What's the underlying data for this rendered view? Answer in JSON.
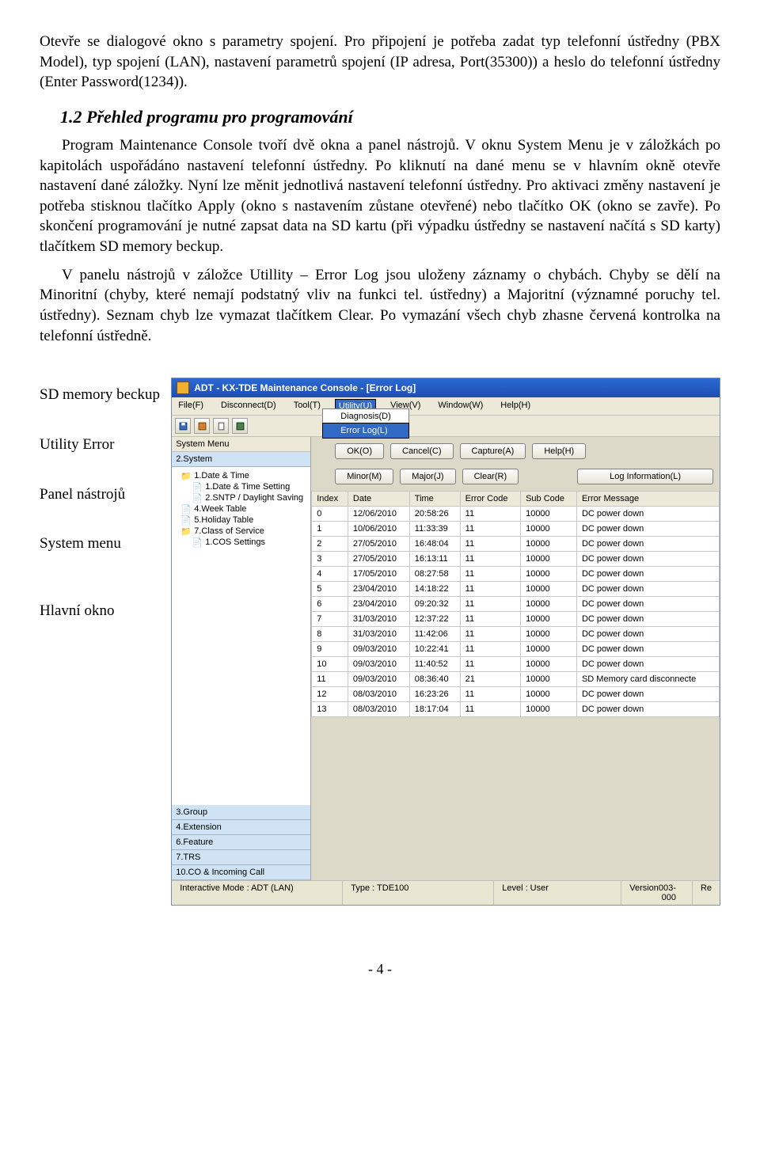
{
  "doc": {
    "para1": "Otevře se dialogové okno s parametry spojení. Pro připojení je potřeba zadat typ telefonní ústředny (PBX Model), typ spojení (LAN), nastavení parametrů spojení (IP adresa, Port(35300)) a heslo do telefonní ústředny (Enter Password(1234)).",
    "section_title": "1.2   Přehled programu pro programování",
    "para2": "Program Maintenance Console tvoří dvě okna a panel nástrojů. V oknu System Menu je v záložkách po kapitolách uspořádáno nastavení telefonní ústředny. Po kliknutí na dané menu se v hlavním okně otevře nastavení dané záložky. Nyní lze měnit jednotlivá nastavení telefonní ústředny. Pro aktivaci změny nastavení je potřeba stisknou tlačítko Apply (okno s nastavením zůstane otevřené) nebo tlačítko OK (okno se zavře). Po skončení programování je nutné zapsat data na SD kartu (při výpadku ústředny se nastavení načítá s SD karty) tlačítkem SD memory beckup.",
    "para3": "V panelu nástrojů v záložce Utillity – Error Log jsou uloženy záznamy o chybách. Chyby se dělí na Minoritní (chyby, které nemají podstatný vliv na funkci tel. ústředny) a Majoritní (významné poruchy tel. ústředny). Seznam chyb lze vymazat tlačítkem Clear. Po vymazání všech chyb zhasne červená kontrolka na telefonní ústředně.",
    "footer": "- 4 -"
  },
  "labels": {
    "l1": "SD memory beckup",
    "l2": "Utility Error",
    "l3": "Panel nástrojů",
    "l4": "System menu",
    "l5": "Hlavní okno"
  },
  "app": {
    "title": "ADT - KX-TDE Maintenance Console - [Error Log]",
    "menu": [
      "File(F)",
      "Disconnect(D)",
      "Tool(T)",
      "Utility(U)",
      "View(V)",
      "Window(W)",
      "Help(H)"
    ],
    "dropdown": {
      "item1": "Diagnosis(D)",
      "item2": "Error Log(L)"
    },
    "sidebar_head": "System Menu",
    "acc_top": "2.System",
    "tree": [
      "1.Date & Time",
      "1.Date & Time Setting",
      "2.SNTP / Daylight Saving",
      "4.Week Table",
      "5.Holiday Table",
      "7.Class of Service",
      "1.COS Settings"
    ],
    "acc_bottom": [
      "3.Group",
      "4.Extension",
      "6.Feature",
      "7.TRS",
      "10.CO & Incoming Call"
    ],
    "buttons1": [
      "OK(O)",
      "Cancel(C)",
      "Capture(A)",
      "Help(H)"
    ],
    "buttons2": [
      "Minor(M)",
      "Major(J)",
      "Clear(R)",
      "Log Information(L)"
    ],
    "grid": {
      "headers": [
        "Index",
        "Date",
        "Time",
        "Error Code",
        "Sub Code",
        "Error Message"
      ],
      "rows": [
        [
          "0",
          "12/06/2010",
          "20:58:26",
          "11",
          "10000",
          "DC power down"
        ],
        [
          "1",
          "10/06/2010",
          "11:33:39",
          "11",
          "10000",
          "DC power down"
        ],
        [
          "2",
          "27/05/2010",
          "16:48:04",
          "11",
          "10000",
          "DC power down"
        ],
        [
          "3",
          "27/05/2010",
          "16:13:11",
          "11",
          "10000",
          "DC power down"
        ],
        [
          "4",
          "17/05/2010",
          "08:27:58",
          "11",
          "10000",
          "DC power down"
        ],
        [
          "5",
          "23/04/2010",
          "14:18:22",
          "11",
          "10000",
          "DC power down"
        ],
        [
          "6",
          "23/04/2010",
          "09:20:32",
          "11",
          "10000",
          "DC power down"
        ],
        [
          "7",
          "31/03/2010",
          "12:37:22",
          "11",
          "10000",
          "DC power down"
        ],
        [
          "8",
          "31/03/2010",
          "11:42:06",
          "11",
          "10000",
          "DC power down"
        ],
        [
          "9",
          "09/03/2010",
          "10:22:41",
          "11",
          "10000",
          "DC power down"
        ],
        [
          "10",
          "09/03/2010",
          "11:40:52",
          "11",
          "10000",
          "DC power down"
        ],
        [
          "11",
          "09/03/2010",
          "08:36:40",
          "21",
          "10000",
          "SD Memory card disconnecte"
        ],
        [
          "12",
          "08/03/2010",
          "16:23:26",
          "11",
          "10000",
          "DC power down"
        ],
        [
          "13",
          "08/03/2010",
          "18:17:04",
          "11",
          "10000",
          "DC power down"
        ]
      ]
    },
    "status": {
      "mode": "Interactive Mode : ADT (LAN)",
      "type": "Type : TDE100",
      "level": "Level : User",
      "version": "Version003-000",
      "re": "Re"
    }
  }
}
